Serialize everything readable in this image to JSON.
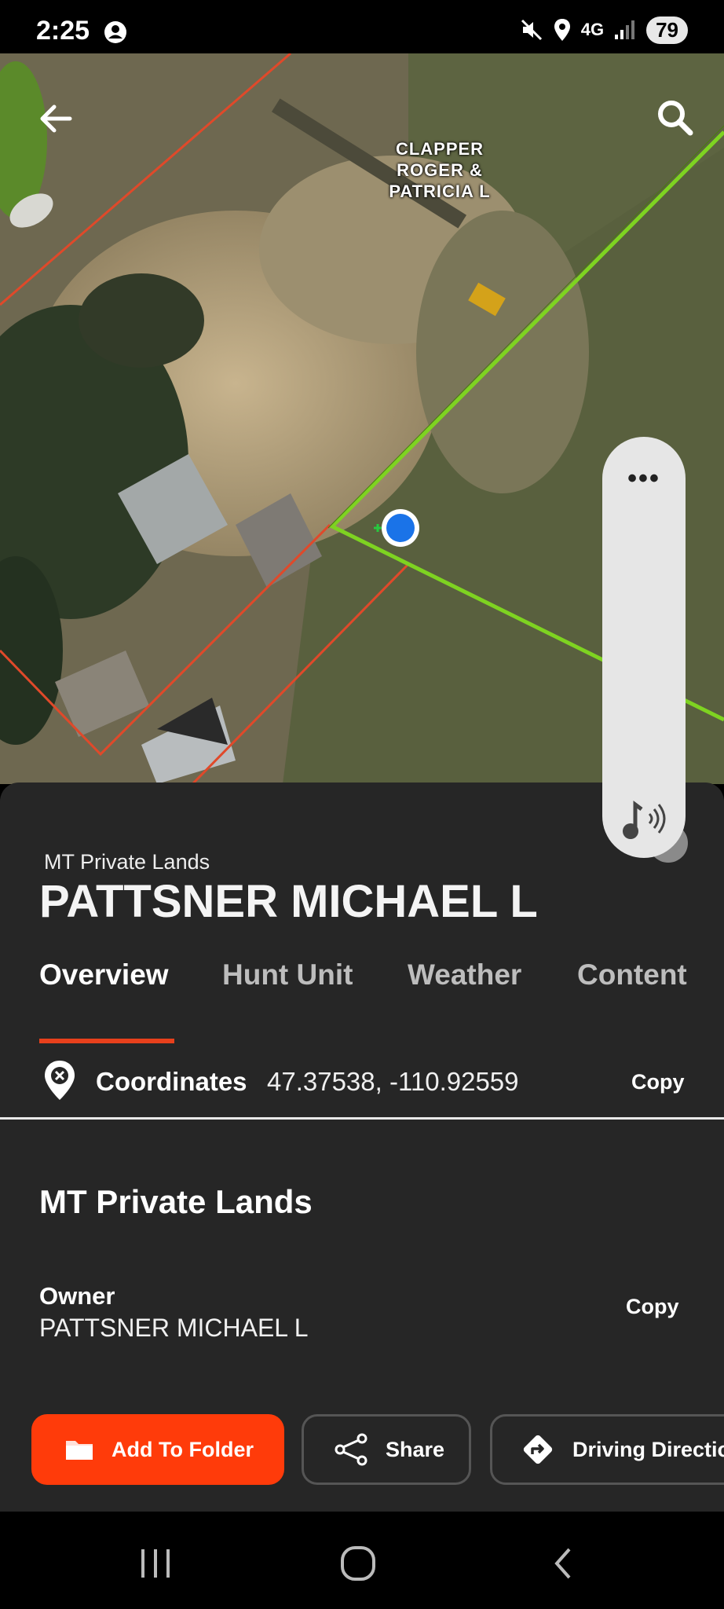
{
  "status_bar": {
    "time": "2:25",
    "network": "4G",
    "battery": "79"
  },
  "map": {
    "parcel_label_lines": [
      "CLAPPER",
      "ROGER &",
      "PATRICIA L"
    ],
    "back_icon": "arrow-left-icon",
    "search_icon": "search-icon"
  },
  "side_control": {
    "menu_icon": "more-horizontal-icon",
    "audio_icon": "audio-notification-icon"
  },
  "panel": {
    "layer_name": "MT Private Lands",
    "title": "PATTSNER MICHAEL L",
    "tabs": [
      {
        "label": "Overview",
        "active": true
      },
      {
        "label": "Hunt Unit",
        "active": false
      },
      {
        "label": "Weather",
        "active": false
      },
      {
        "label": "Content",
        "active": false
      }
    ],
    "coordinates": {
      "label": "Coordinates",
      "value": "47.37538, -110.92559",
      "copy_label": "Copy"
    },
    "section_title": "MT Private Lands",
    "owner": {
      "label": "Owner",
      "value": "PATTSNER MICHAEL L",
      "copy_label": "Copy"
    },
    "actions": [
      {
        "label": "Add To Folder",
        "icon": "folder-icon"
      },
      {
        "label": "Share",
        "icon": "share-icon"
      },
      {
        "label": "Driving Directio",
        "icon": "directions-icon"
      }
    ]
  },
  "colors": {
    "accent": "#ff3b0a",
    "tab_underline": "#e8401c",
    "panel_bg": "#262626",
    "boundary_red": "#e0492a",
    "boundary_green": "#7ed321",
    "location_dot": "#1a73e8"
  }
}
